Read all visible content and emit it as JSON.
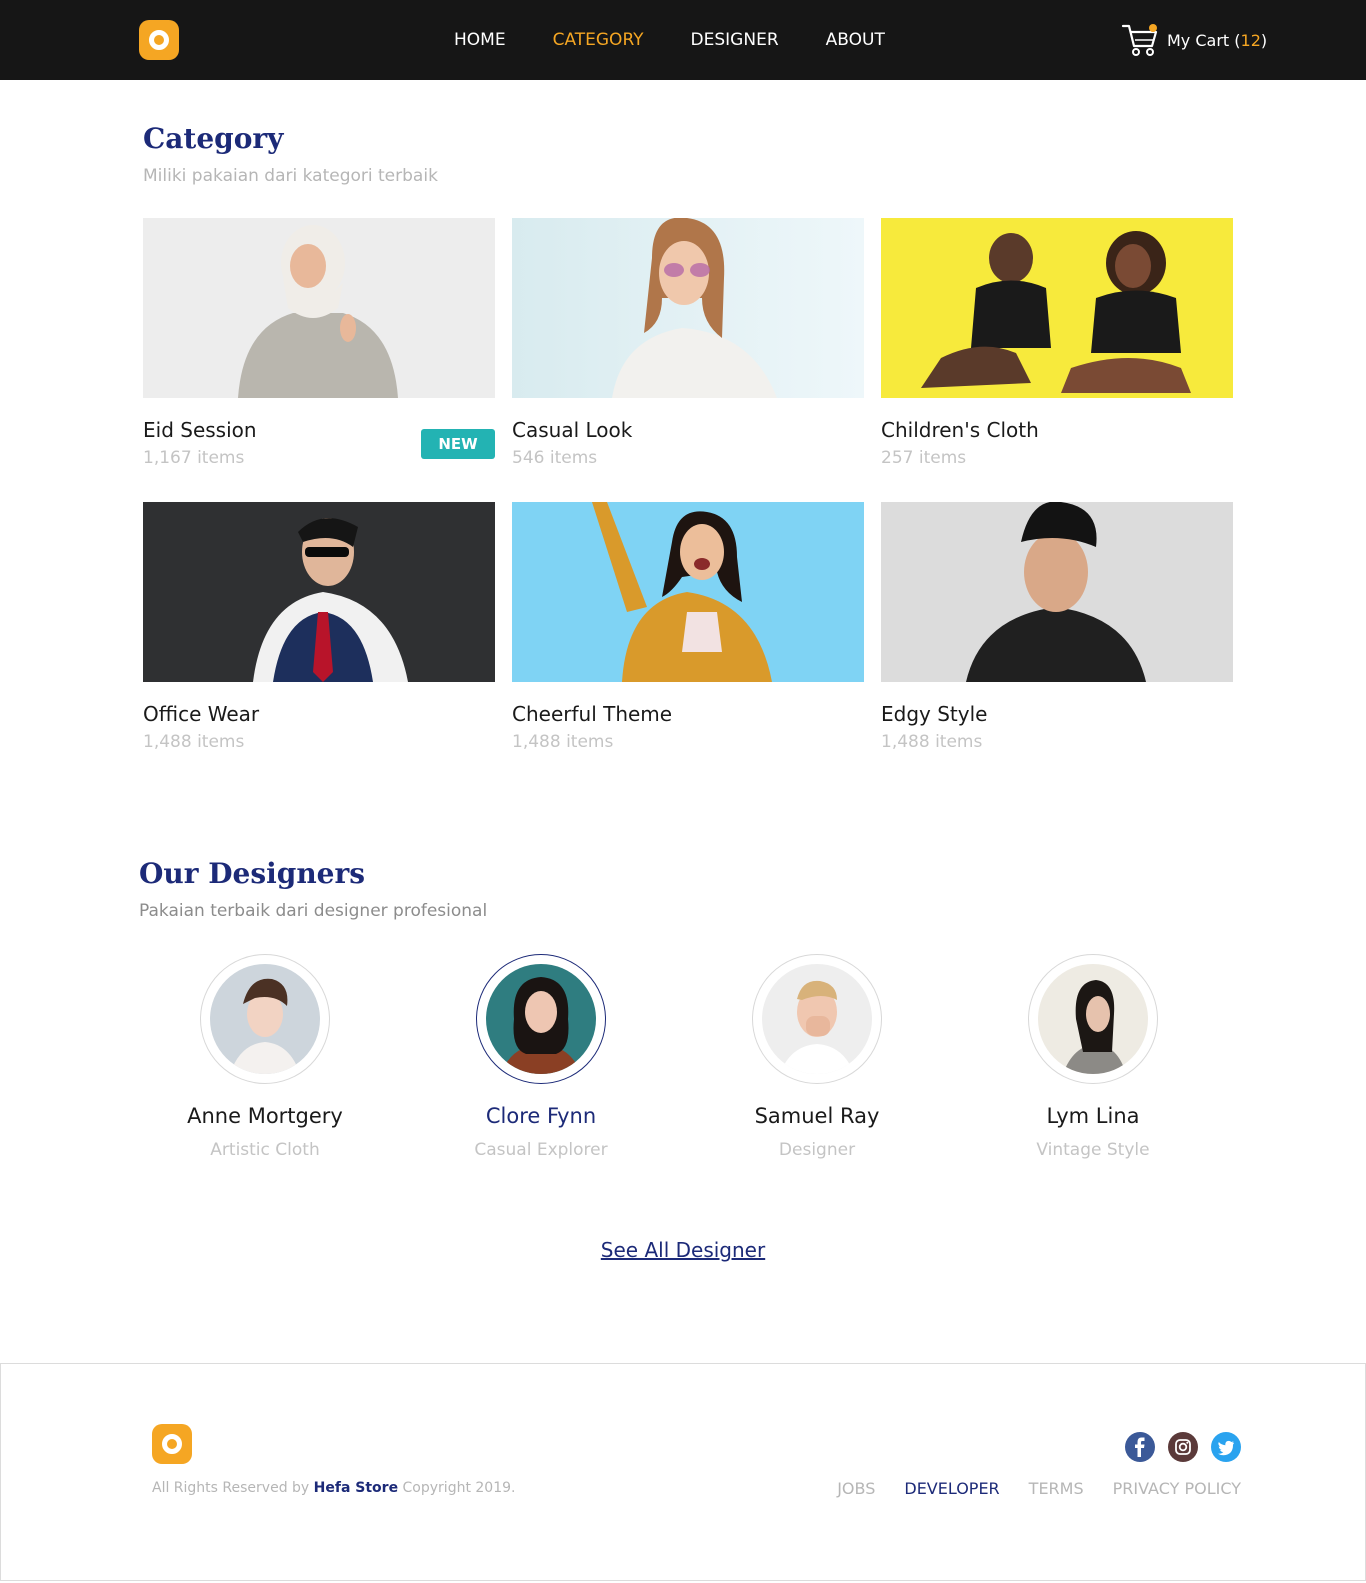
{
  "nav": {
    "links": [
      "HOME",
      "CATEGORY",
      "DESIGNER",
      "ABOUT"
    ],
    "active": "CATEGORY",
    "cart_label": "My Cart",
    "cart_count": "12"
  },
  "category": {
    "title": "Category",
    "subtitle": "Miliki pakaian dari kategori terbaik",
    "cards": [
      {
        "name": "Eid Session",
        "count": "1,167 items",
        "badge": "NEW"
      },
      {
        "name": "Casual Look",
        "count": "546 items"
      },
      {
        "name": "Children's Cloth",
        "count": "257 items"
      },
      {
        "name": "Office Wear",
        "count": "1,488 items"
      },
      {
        "name": "Cheerful Theme",
        "count": "1,488 items"
      },
      {
        "name": "Edgy Style",
        "count": "1,488 items"
      }
    ]
  },
  "designers": {
    "title": "Our Designers",
    "subtitle": "Pakaian terbaik dari designer profesional",
    "items": [
      {
        "name": "Anne Mortgery",
        "role": "Artistic Cloth"
      },
      {
        "name": "Clore Fynn",
        "role": "Casual Explorer"
      },
      {
        "name": "Samuel Ray",
        "role": "Designer"
      },
      {
        "name": "Lym Lina",
        "role": "Vintage Style"
      }
    ],
    "see_all": "See All Designer"
  },
  "footer": {
    "copyright_prefix": "All Rights Reserved by",
    "brand": "Hefa Store",
    "copyright_suffix": "Copyright 2019.",
    "links": [
      "JOBS",
      "DEVELOPER",
      "TERMS",
      "PRIVACY POLICY"
    ],
    "active_link": "DEVELOPER",
    "socials": [
      "facebook-icon",
      "instagram-icon",
      "twitter-icon"
    ]
  },
  "colors": {
    "accent": "#f5a623",
    "brand_blue": "#1c2a78",
    "badge": "#23b3b3",
    "navbar": "#161616"
  }
}
